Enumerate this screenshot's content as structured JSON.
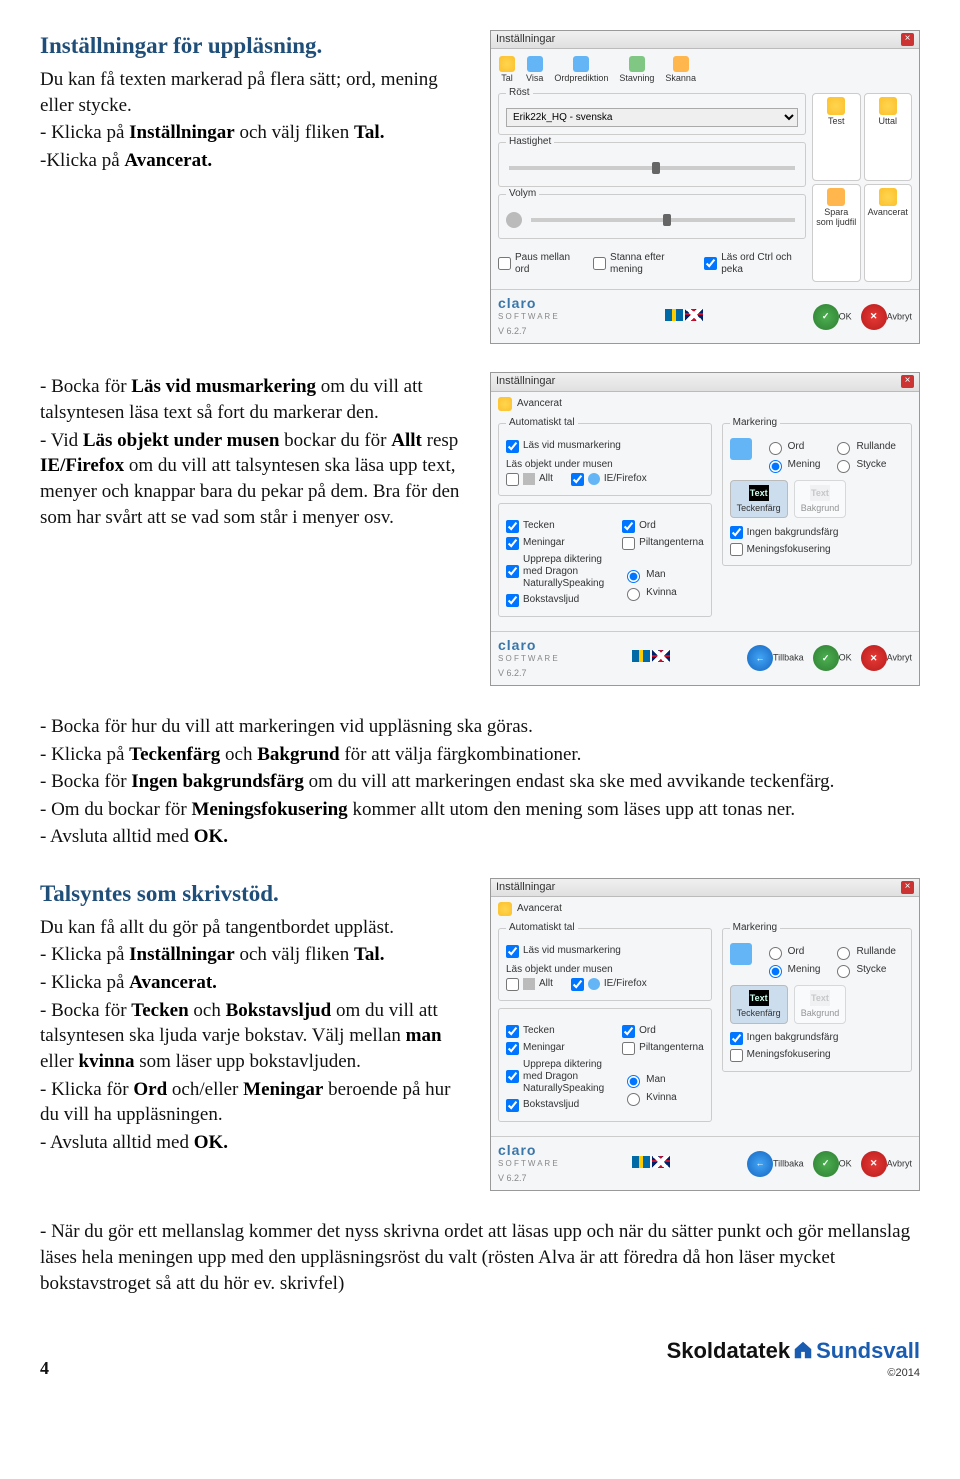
{
  "s1": {
    "h": "Inställningar för uppläsning.",
    "p1": "Du kan få texten markerad på flera sätt; ord, mening eller stycke.",
    "p2a": "- Klicka på ",
    "p2b": "Inställningar",
    "p2c": " och välj fliken ",
    "p2d": "Tal.",
    "p3a": "-Klicka på ",
    "p3b": "Avancerat."
  },
  "s2": {
    "p1a": "- Bocka för ",
    "p1b": "Läs vid musmarkering",
    "p1c": " om du vill att talsyntesen läsa text så fort du markerar den.",
    "p2a": "- Vid ",
    "p2b": "Läs objekt under musen",
    "p2c": " bockar du för ",
    "p2d": "Allt",
    "p2e": " resp ",
    "p2f": "IE/Firefox",
    "p2g": " om du vill att talsyntesen ska läsa upp text, menyer och knappar bara du pekar på dem. Bra för den som har svårt att se vad som står i menyer osv."
  },
  "s3": {
    "p1": "- Bocka för hur du vill att markeringen vid uppläsning ska göras.",
    "p2a": "- Klicka på ",
    "p2b": "Teckenfärg",
    "p2c": " och ",
    "p2d": "Bakgrund",
    "p2e": " för att välja färgkombinationer.",
    "p3a": "- Bocka för ",
    "p3b": "Ingen bakgrundsfärg",
    "p3c": " om du vill att markeringen endast ska ske med avvikande teckenfärg.",
    "p4a": "- Om du bockar för ",
    "p4b": "Meningsfokusering",
    "p4c": " kommer allt utom den mening som läses upp att tonas ner.",
    "p5a": "- Avsluta alltid med ",
    "p5b": "OK."
  },
  "s4": {
    "h": "Talsyntes som skrivstöd.",
    "p1": "Du kan få allt du gör på tangentbordet uppläst.",
    "p2a": "- Klicka på ",
    "p2b": "Inställningar",
    "p2c": " och välj fliken ",
    "p2d": "Tal.",
    "p3a": "- Klicka på ",
    "p3b": "Avancerat.",
    "p4a": "- Bocka för ",
    "p4b": "Tecken",
    "p4c": " och ",
    "p4d": "Bokstavsljud",
    "p4e": " om du vill att talsyntesen ska ljuda varje bokstav. Välj mellan ",
    "p4f": "man",
    "p4g": " eller ",
    "p4h": "kvinna",
    "p4i": " som läser upp bokstavljuden.",
    "p5a": "- Klicka för ",
    "p5b": "Ord",
    "p5c": " och/eller ",
    "p5d": "Meningar",
    "p5e": " beroende på hur du vill ha uppläsningen.",
    "p6a": "- Avsluta alltid med ",
    "p6b": "OK."
  },
  "s5": {
    "p1": "- När du gör ett mellanslag kommer det nyss skrivna ordet att läsas upp och när du sätter punkt och gör mellanslag läses hela meningen upp med den uppläsningsröst du valt (rösten Alva är att föredra då hon läser mycket bokstavstroget så att du hör ev. skrivfel)"
  },
  "footer": {
    "page": "4",
    "brand1": "Skoldatatek",
    "brand2": "Sundsvall",
    "year": "©2014"
  },
  "win": {
    "title": "Inställningar",
    "tabs": [
      "Tal",
      "Visa",
      "Ordprediktion",
      "Stavning",
      "Skanna"
    ],
    "rost": "Röst",
    "voice": "Erik22k_HQ - svenska",
    "hastighet": "Hastighet",
    "volym": "Volym",
    "side": [
      "Test",
      "Uttal",
      "Spara som ljudfil",
      "Avancerat"
    ],
    "chks": [
      "Paus mellan ord",
      "Stanna efter mening",
      "Läs ord Ctrl och peka"
    ],
    "ok": "OK",
    "avbryt": "Avbryt",
    "tillbaka": "Tillbaka",
    "ver": "V 6.2.7",
    "claro": "claro",
    "sw": "S O F T W A R E"
  },
  "adv": {
    "avancerat": "Avancerat",
    "auto": "Automatiskt tal",
    "lasvid": "Läs vid musmarkering",
    "lasobj": "Läs objekt under musen",
    "allt": "Allt",
    "ie": "IE/Firefox",
    "tecken": "Tecken",
    "ord": "Ord",
    "meningar": "Meningar",
    "pil": "Piltangenterna",
    "dragon": "Upprepa diktering med Dragon NaturallySpeaking",
    "bokstavs": "Bokstavsljud",
    "man": "Man",
    "kvinna": "Kvinna",
    "mark": "Markering",
    "mord": "Ord",
    "rullande": "Rullande",
    "mening": "Mening",
    "stycke": "Stycke",
    "teckenfarg": "Teckenfärg",
    "bakgrund": "Bakgrund",
    "text": "Text",
    "ingen": "Ingen bakgrundsfärg",
    "mfok": "Meningsfokusering"
  }
}
